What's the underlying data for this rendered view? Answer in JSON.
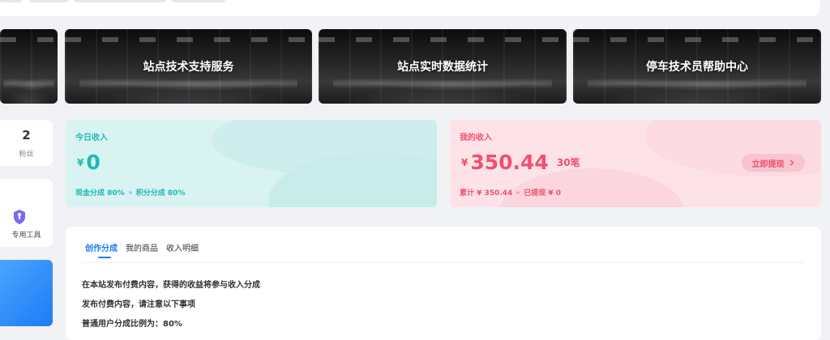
{
  "banners": [
    {
      "title": ""
    },
    {
      "title": "站点技术支持服务"
    },
    {
      "title": "站点实时数据统计"
    },
    {
      "title": "停车技术员帮助中心"
    }
  ],
  "sidebar": {
    "fans_count": "2",
    "fans_label": "粉丝",
    "tool_icon": "shield-icon",
    "tool_label": "专用工具"
  },
  "today_income": {
    "title": "今日收入",
    "currency": "¥",
    "amount": "0",
    "cash_share": "现金分成 80%",
    "points_share": "积分分成 80%"
  },
  "my_income": {
    "title": "我的收入",
    "currency": "¥",
    "amount": "350.44",
    "count": "30笔",
    "total": "累计 ¥ 350.44",
    "withdrawn": "已提现 ¥ 0",
    "withdraw_label": "立即提现",
    "withdraw_icon": "chevron-right-icon"
  },
  "tabs": [
    {
      "label": "创作分成",
      "active": true
    },
    {
      "label": "我的商品",
      "active": false
    },
    {
      "label": "收入明细",
      "active": false
    }
  ],
  "content": {
    "lines": [
      "在本站发布付费内容，获得的收益将参与收入分成",
      "发布付费内容，请注意以下事项",
      "普通用户分成比例为：80%"
    ]
  },
  "colors": {
    "accent": "#1e7bf5",
    "teal": "#1bbdb2",
    "pink": "#f0506e"
  }
}
